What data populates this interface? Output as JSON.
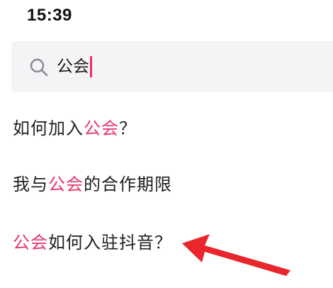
{
  "status_bar": {
    "time": "15:39"
  },
  "search": {
    "query": "公会"
  },
  "suggestions": [
    {
      "before": "如何加入",
      "keyword": "公会",
      "after": "？"
    },
    {
      "before": "我与",
      "keyword": "公会",
      "after": "的合作期限"
    },
    {
      "before": "",
      "keyword": "公会",
      "after": "如何入驻抖音？"
    }
  ],
  "colors": {
    "highlight": "#e6356a",
    "caret": "#ef2e5a",
    "arrow": "#e8262b",
    "search_bg": "#f4f4f6"
  },
  "icons": {
    "search": "search-icon",
    "annotation": "red-arrow-icon"
  }
}
